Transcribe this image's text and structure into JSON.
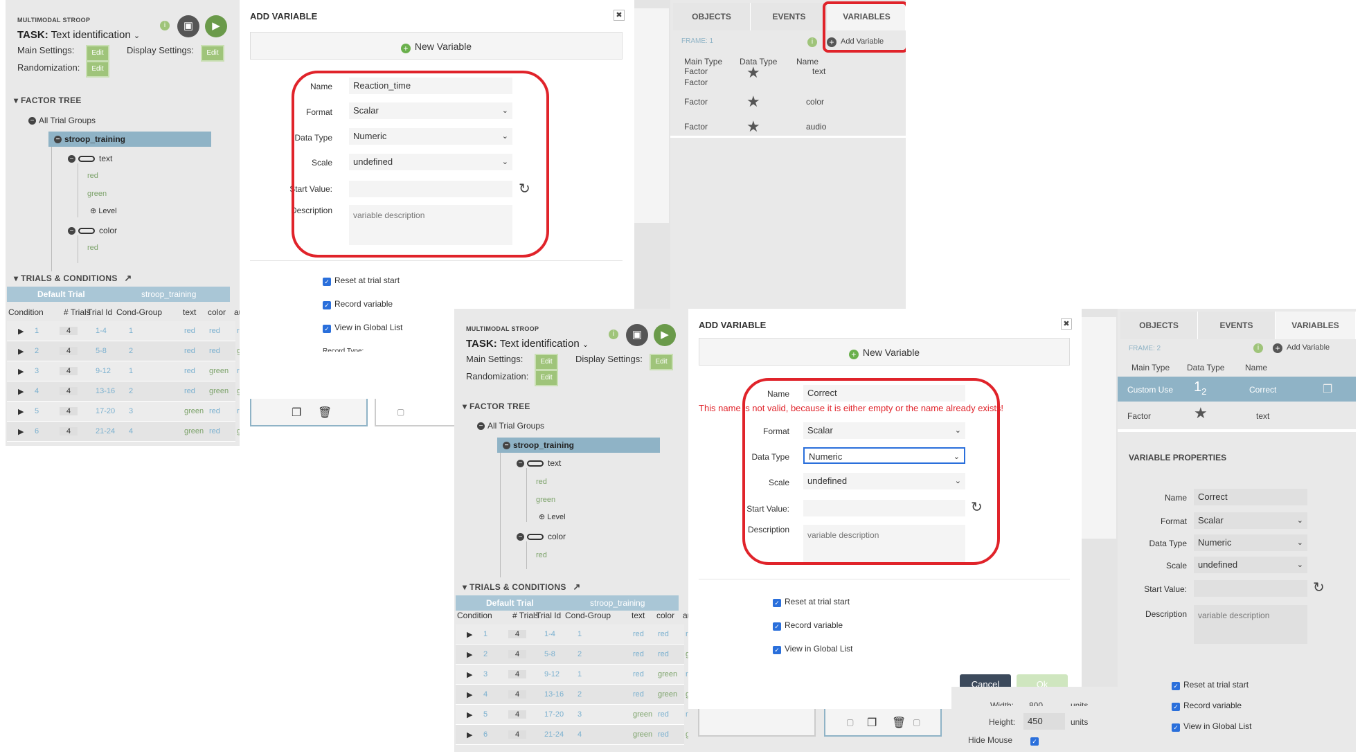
{
  "left": {
    "app_title": "MULTIMODAL STROOP",
    "task_label": "TASK:",
    "task_value": "Text identification",
    "main_settings": "Main Settings:",
    "display_settings": "Display Settings:",
    "randomization": "Randomization:",
    "edit": "Edit",
    "factor_tree": "FACTOR TREE",
    "all_trial_groups": "All Trial Groups",
    "group": "stroop_training",
    "factor_text": "text",
    "level_red": "red",
    "level_green": "green",
    "add_level": "Level",
    "factor_color": "color",
    "level_red2": "red",
    "trials_conditions": "TRIALS & CONDITIONS",
    "default_trial": "Default Trial",
    "trial_group": "stroop_training",
    "columns": [
      "Condition",
      "# Trials",
      "Trial Id",
      "Cond-Group",
      "text",
      "color",
      "au"
    ],
    "rows": [
      {
        "cond": "1",
        "trials": "4",
        "id": "1-4",
        "group": "1",
        "text": "red",
        "color": "red",
        "au": "r"
      },
      {
        "cond": "2",
        "trials": "4",
        "id": "5-8",
        "group": "2",
        "text": "red",
        "color": "red",
        "au": "gr"
      },
      {
        "cond": "3",
        "trials": "4",
        "id": "9-12",
        "group": "1",
        "text": "red",
        "color": "green",
        "au": "r"
      },
      {
        "cond": "4",
        "trials": "4",
        "id": "13-16",
        "group": "2",
        "text": "red",
        "color": "green",
        "au": "gr"
      },
      {
        "cond": "5",
        "trials": "4",
        "id": "17-20",
        "group": "3",
        "text": "green",
        "color": "red",
        "au": "r"
      },
      {
        "cond": "6",
        "trials": "4",
        "id": "21-24",
        "group": "4",
        "text": "green",
        "color": "red",
        "au": "gr"
      }
    ]
  },
  "dialog1": {
    "title": "ADD VARIABLE",
    "close": "✖",
    "new_variable": "New Variable",
    "name_label": "Name",
    "name_value": "Reaction_time",
    "format_label": "Format",
    "format_value": "Scalar",
    "datatype_label": "Data Type",
    "datatype_value": "Numeric",
    "scale_label": "Scale",
    "scale_value": "undefined",
    "start_label": "Start Value:",
    "desc_label": "Description",
    "desc_placeholder": "variable description",
    "reset": "Reset at trial start",
    "record": "Record variable",
    "global": "View in Global List",
    "record_type_cut": "Record Type:"
  },
  "right1": {
    "tab_objects": "OBJECTS",
    "tab_events": "EVENTS",
    "tab_variables": "VARIABLES",
    "frame": "FRAME: 1",
    "add_variable": "Add Variable",
    "h_main": "Main Type",
    "h_main2": "Factor",
    "h_data": "Data Type",
    "h_name": "Name",
    "rows": [
      {
        "type": "Factor",
        "name": "text"
      },
      {
        "type": "Factor",
        "name": "color"
      },
      {
        "type": "Factor",
        "name": "audio"
      }
    ]
  },
  "dialog2": {
    "title": "ADD VARIABLE",
    "close": "✖",
    "new_variable": "New Variable",
    "name_label": "Name",
    "name_value": "Correct",
    "error": "This name is not valid, because it is either empty or the name already exists!",
    "format_label": "Format",
    "format_value": "Scalar",
    "datatype_label": "Data Type",
    "datatype_value": "Numeric",
    "scale_label": "Scale",
    "scale_value": "undefined",
    "start_label": "Start Value:",
    "desc_label": "Description",
    "desc_placeholder": "variable description",
    "reset": "Reset at trial start",
    "record": "Record variable",
    "global": "View in Global List",
    "cancel": "Cancel",
    "ok": "Ok"
  },
  "middle": {
    "height_label": "Height:",
    "height_value": "450",
    "width_label": "Width:",
    "width_value": "800",
    "units": "units",
    "hide_mouse": "Hide Mouse"
  },
  "right2": {
    "tab_objects": "OBJECTS",
    "tab_events": "EVENTS",
    "tab_variables": "VARIABLES",
    "frame": "FRAME: 2",
    "add_variable": "Add Variable",
    "h_main": "Main Type",
    "h_data": "Data Type",
    "h_name": "Name",
    "row1_type": "Custom Use",
    "row1_name": "Correct",
    "row2_type": "Factor",
    "row2_name": "text",
    "props_title": "VARIABLE PROPERTIES",
    "name_label": "Name",
    "name_value": "Correct",
    "format_label": "Format",
    "format_value": "Scalar",
    "datatype_label": "Data Type",
    "datatype_value": "Numeric",
    "scale_label": "Scale",
    "scale_value": "undefined",
    "start_label": "Start Value:",
    "desc_label": "Description",
    "desc_placeholder": "variable description",
    "reset": "Reset at trial start",
    "record": "Record variable",
    "global": "View in Global List"
  }
}
